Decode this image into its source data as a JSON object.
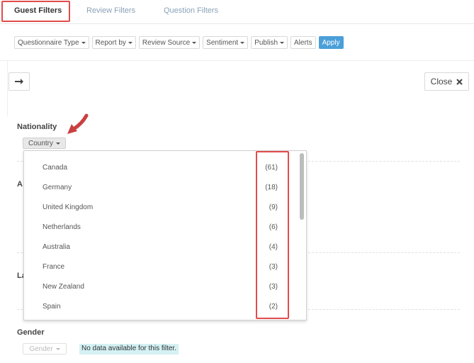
{
  "tabs": {
    "guest": "Guest Filters",
    "review": "Review Filters",
    "question": "Question Filters"
  },
  "toolbar": {
    "questionnaire_type": "Questionnaire Type",
    "report_by": "Report by",
    "review_source": "Review Source",
    "sentiment": "Sentiment",
    "publish": "Publish",
    "alerts": "Alerts",
    "apply": "Apply"
  },
  "panel": {
    "close_label": "Close"
  },
  "sections": {
    "nationality": "Nationality",
    "age_initial": "A",
    "language_initial": "La",
    "gender": "Gender"
  },
  "nationality": {
    "dropdown_label": "Country",
    "items": [
      {
        "label": "Canada",
        "count": "(61)"
      },
      {
        "label": "Germany",
        "count": "(18)"
      },
      {
        "label": "United Kingdom",
        "count": "(9)"
      },
      {
        "label": "Netherlands",
        "count": "(6)"
      },
      {
        "label": "Australia",
        "count": "(4)"
      },
      {
        "label": "France",
        "count": "(3)"
      },
      {
        "label": "New Zealand",
        "count": "(3)"
      },
      {
        "label": "Spain",
        "count": "(2)"
      }
    ]
  },
  "gender": {
    "dropdown_label": "Gender",
    "empty_message": "No data available for this filter."
  },
  "colors": {
    "highlight": "#e24b4b",
    "apply_bg": "#4a9fd8",
    "tab_inactive": "#8aa1b8",
    "no_data_bg": "#d4f1f4"
  }
}
